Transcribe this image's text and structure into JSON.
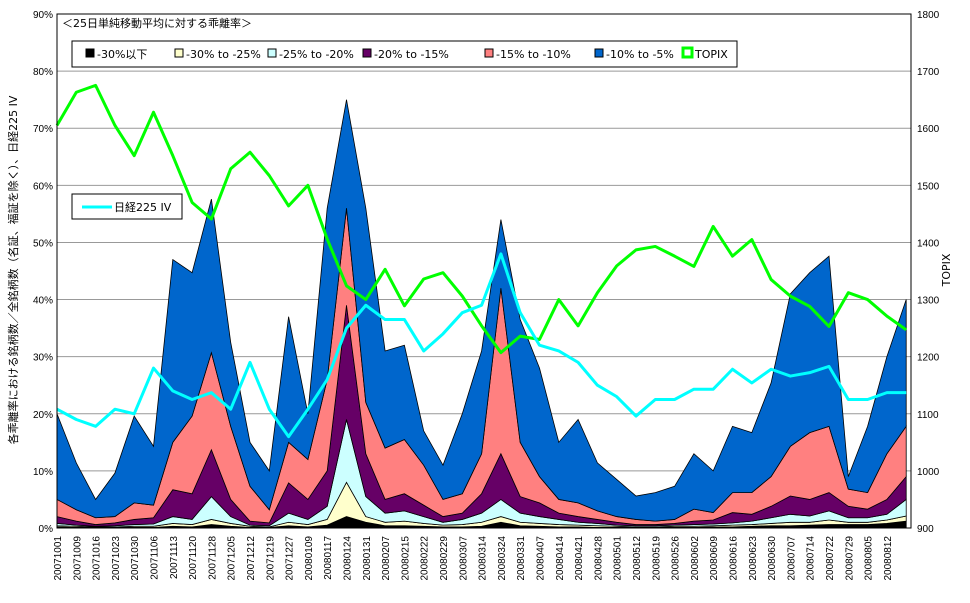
{
  "chart_data": {
    "type": "area",
    "stacked": true,
    "title": "＜25日単純移動平均に対する乖離率＞",
    "ylabel": "各乖離率における銘柄数／全銘柄数（名証、福証を除く）、日経225 IV",
    "y2label": "TOPIX",
    "ylim": [
      0,
      90
    ],
    "y2lim": [
      900,
      1800
    ],
    "yticks": [
      "0%",
      "10%",
      "20%",
      "30%",
      "40%",
      "50%",
      "60%",
      "70%",
      "80%",
      "90%"
    ],
    "y2ticks": [
      "900",
      "1000",
      "1100",
      "1200",
      "1300",
      "1400",
      "1500",
      "1600",
      "1700",
      "1800"
    ],
    "grid": true,
    "legend": "top",
    "categories": [
      "20071001",
      "20071009",
      "20071016",
      "20071023",
      "20071030",
      "20071106",
      "20071113",
      "20071120",
      "20071128",
      "20071205",
      "20071212",
      "20071219",
      "20071227",
      "20080109",
      "20080117",
      "20080124",
      "20080131",
      "20080207",
      "20080215",
      "20080222",
      "20080229",
      "20080307",
      "20080314",
      "20080324",
      "20080331",
      "20080407",
      "20080414",
      "20080421",
      "20080428",
      "20080501",
      "20080512",
      "20080519",
      "20080526",
      "20080602",
      "20080609",
      "20080616",
      "20080623",
      "20080630",
      "20080707",
      "20080714",
      "20080722",
      "20080729",
      "20080805",
      "20080812"
    ],
    "series": [
      {
        "name": "-30%以下",
        "color": "#000000",
        "values": [
          0.2,
          0.1,
          0.1,
          0.1,
          0.1,
          0.1,
          0.3,
          0.2,
          0.6,
          0.3,
          0.1,
          0.1,
          0.4,
          0.2,
          0.5,
          2,
          1,
          0.4,
          0.4,
          0.3,
          0.2,
          0.2,
          0.3,
          1,
          0.4,
          0.3,
          0.2,
          0.2,
          0.1,
          0.1,
          0.1,
          0.1,
          0.1,
          0.1,
          0.2,
          0.2,
          0.3,
          0.4,
          0.4,
          0.5,
          0.6,
          0.6,
          0.6,
          0.8,
          1.2
        ]
      },
      {
        "name": "-30% to -25%",
        "color": "#FFFFCC",
        "values": [
          0.2,
          0.2,
          0.1,
          0.1,
          0.2,
          0.2,
          0.5,
          0.4,
          0.9,
          0.5,
          0.2,
          0.1,
          0.6,
          0.4,
          1,
          6,
          1,
          0.6,
          0.8,
          0.5,
          0.3,
          0.4,
          0.7,
          1,
          0.6,
          0.5,
          0.4,
          0.3,
          0.3,
          0.2,
          0.1,
          0.1,
          0.2,
          0.2,
          0.2,
          0.3,
          0.3,
          0.4,
          0.6,
          0.5,
          0.8,
          0.4,
          0.4,
          0.6,
          0.9
        ]
      },
      {
        "name": "-25% to -20%",
        "color": "#CCFFFF",
        "values": [
          0.4,
          0.2,
          0.1,
          0.2,
          0.3,
          0.4,
          1.2,
          0.9,
          4,
          1.2,
          0.2,
          0.2,
          1.6,
          0.9,
          2.3,
          11,
          3.5,
          1.6,
          1.8,
          1.2,
          0.5,
          0.9,
          1.6,
          3,
          1.6,
          1.2,
          0.9,
          0.5,
          0.4,
          0.2,
          0.2,
          0.2,
          0.2,
          0.3,
          0.3,
          0.4,
          0.6,
          1,
          1.4,
          1.1,
          1.6,
          0.8,
          0.8,
          1,
          2.9
        ]
      },
      {
        "name": "-20% to -15%",
        "color": "#660066",
        "values": [
          1.2,
          0.7,
          0.3,
          0.5,
          0.9,
          1.1,
          4.7,
          4.5,
          8.2,
          3,
          0.7,
          0.5,
          5.3,
          3.5,
          6.2,
          20,
          7.5,
          2.4,
          3,
          2,
          1,
          1.1,
          3.4,
          8,
          2.9,
          2.4,
          1.1,
          1,
          0.7,
          0.5,
          0.2,
          0.2,
          0.3,
          0.6,
          0.7,
          1.8,
          1.2,
          2,
          3.2,
          2.9,
          3.2,
          2,
          1.5,
          2.6,
          4
        ]
      },
      {
        "name": "-15% to -10%",
        "color": "#FF8080",
        "values": [
          3,
          2,
          1.2,
          1.1,
          2.9,
          2.2,
          8.3,
          13.6,
          17,
          12.8,
          6.1,
          2.3,
          7.1,
          7,
          16,
          17,
          9,
          9,
          9.5,
          7,
          3,
          3.4,
          7,
          29,
          9.5,
          4.6,
          2.4,
          2.4,
          1.5,
          1,
          0.9,
          0.6,
          0.7,
          2.1,
          1.3,
          3.5,
          3.8,
          5.2,
          8.7,
          11.7,
          11.6,
          3,
          2.9,
          8,
          8.8
        ]
      },
      {
        "name": "-10% to -5%",
        "color": "#0066CC",
        "values": [
          15,
          8.2,
          3.2,
          7.6,
          15.2,
          10.3,
          32,
          25.1,
          26.9,
          14.7,
          7.7,
          6.8,
          22,
          8,
          30,
          19,
          34,
          17,
          16.5,
          6,
          6,
          14,
          18,
          12,
          21.5,
          19,
          10,
          14.6,
          8.4,
          6.5,
          4.1,
          5,
          5.8,
          9.7,
          7.3,
          11.6,
          10.5,
          16.4,
          26.7,
          28,
          29.8,
          2.2,
          11.6,
          17,
          22.2
        ]
      }
    ],
    "lines": [
      {
        "name": "TOPIX",
        "axis": "right",
        "color": "#00FF00",
        "values": [
          1605,
          1663,
          1675,
          1605,
          1552,
          1628,
          1552,
          1470,
          1441,
          1529,
          1558,
          1517,
          1464,
          1500,
          1406,
          1324,
          1300,
          1353,
          1289,
          1336,
          1347,
          1306,
          1254,
          1207,
          1236,
          1230,
          1300,
          1254,
          1312,
          1359,
          1387,
          1393,
          1376,
          1358,
          1428,
          1376,
          1405,
          1335,
          1306,
          1288,
          1253,
          1312,
          1300,
          1271,
          1247
        ]
      },
      {
        "name": "日経225 IV",
        "axis": "left",
        "color": "#00FFFF",
        "values": [
          20.8,
          19,
          17.8,
          20.8,
          20,
          28,
          24,
          22.5,
          23.7,
          20.8,
          29,
          20.8,
          16,
          20.8,
          26,
          35,
          39,
          36.5,
          36.5,
          31,
          34,
          37.7,
          39,
          48,
          37.7,
          32,
          31,
          29,
          25,
          23,
          19.6,
          22.5,
          22.5,
          24.3,
          24.3,
          27.8,
          25.4,
          27.8,
          26.6,
          27.2,
          28.3,
          22.5,
          22.5,
          23.7,
          23.7
        ]
      }
    ]
  }
}
